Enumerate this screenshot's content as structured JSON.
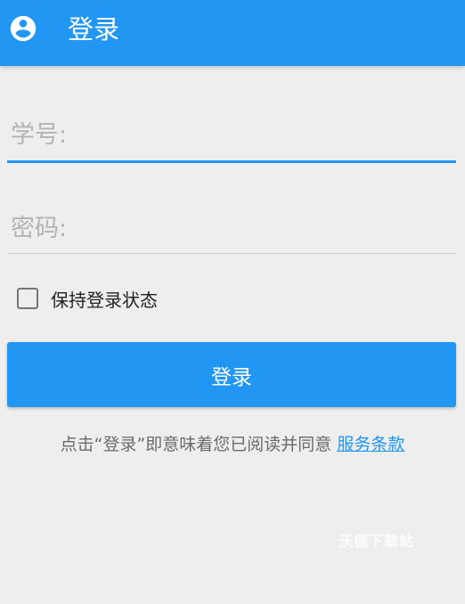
{
  "appbar": {
    "title": "登录",
    "icon": "account-circle-icon"
  },
  "form": {
    "username_placeholder": "学号:",
    "password_placeholder": "密码:",
    "remember_label": "保持登录状态",
    "remember_checked": false,
    "submit_label": "登录"
  },
  "terms": {
    "prefix": "点击“登录”即意味着您已阅读并同意",
    "link_label": "服务条款"
  },
  "watermark": "沃德下载站",
  "colors": {
    "primary": "#2196f3",
    "background": "#eeeeee"
  }
}
